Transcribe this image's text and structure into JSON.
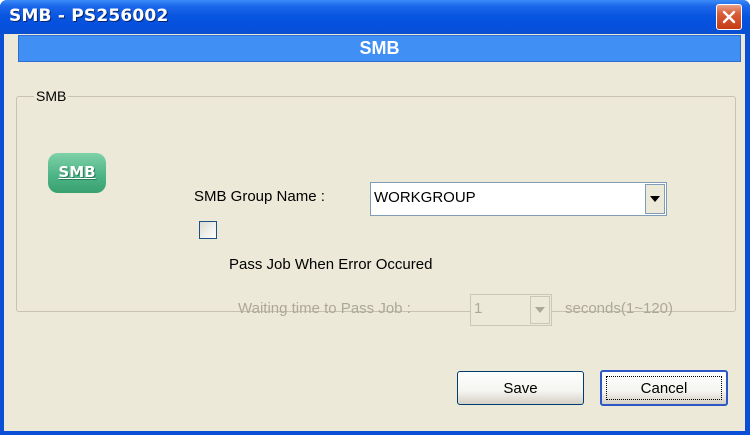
{
  "window": {
    "title": "SMB - PS256002"
  },
  "banner": {
    "title": "SMB"
  },
  "group": {
    "legend": "SMB"
  },
  "icon": {
    "label": "SMB"
  },
  "form": {
    "group_name_label": "SMB Group Name :",
    "group_name_value": "WORKGROUP",
    "pass_job_label": "Pass Job When Error Occured",
    "pass_job_checked": false,
    "waiting_label": "Waiting time to Pass Job :",
    "waiting_value": "1",
    "waiting_unit": "seconds(1~120)"
  },
  "buttons": {
    "save": "Save",
    "cancel": "Cancel"
  },
  "colors": {
    "title_bar": "#0550dc",
    "banner": "#3f8ff5",
    "dialog_bg": "#ece9d8",
    "icon_green": "#4db587",
    "close_red": "#c53b14",
    "disabled_text": "#aca899"
  }
}
